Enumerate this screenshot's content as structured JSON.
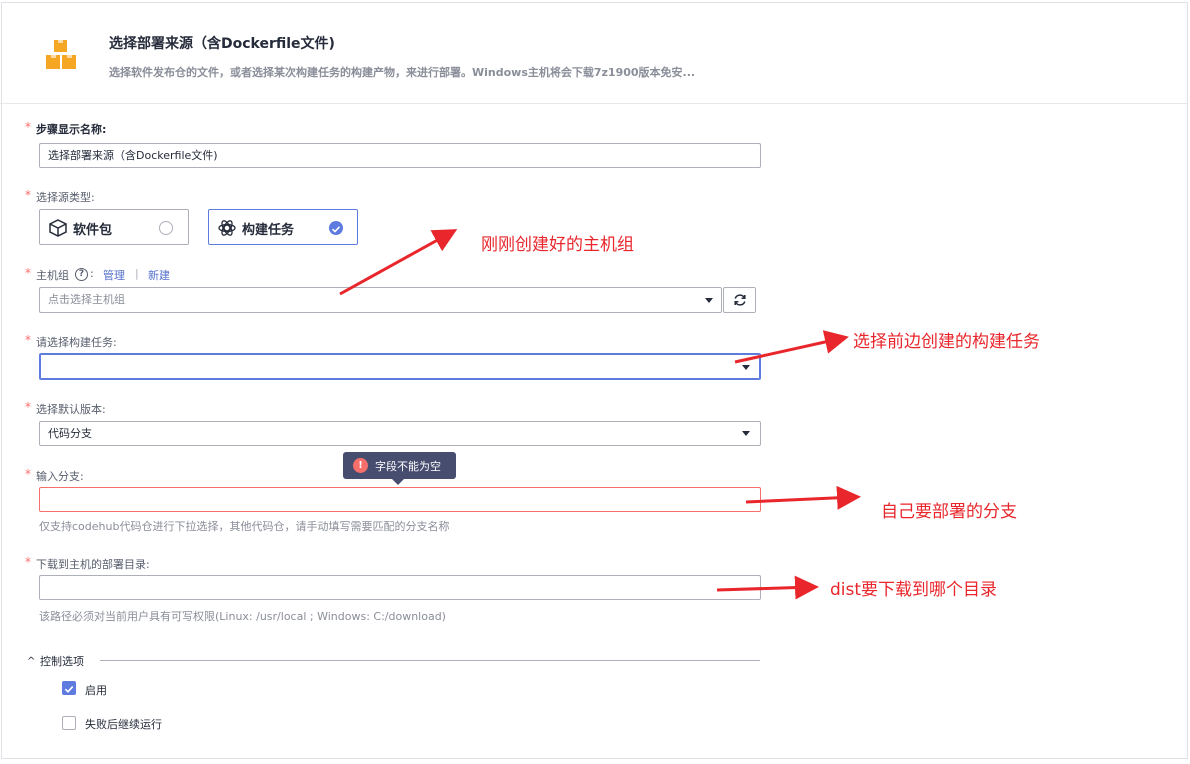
{
  "header": {
    "title": "选择部署来源（含Dockerfile文件)",
    "description": "选择软件发布仓的文件，或者选择某次构建任务的构建产物，来进行部署。Windows主机将会下载7z1900版本免安...",
    "icon": "box-stack-icon",
    "accent_color": "#f5a623"
  },
  "form": {
    "required_mark": "*",
    "step_name": {
      "label": "步骤显示名称:",
      "value": "选择部署来源（含Dockerfile文件)"
    },
    "source_type": {
      "label": "选择源类型:",
      "options": [
        {
          "label": "软件包",
          "icon": "package-icon",
          "selected": false
        },
        {
          "label": "构建任务",
          "icon": "build-gear-icon",
          "selected": true
        }
      ]
    },
    "host_group": {
      "label": "主机组",
      "help": "?",
      "colon": ":",
      "manage_link": "管理",
      "separator": "|",
      "new_link": "新建",
      "placeholder": "点击选择主机组"
    },
    "build_task": {
      "label": "请选择构建任务:",
      "value": ""
    },
    "default_version": {
      "label": "选择默认版本:",
      "value": "代码分支"
    },
    "branch": {
      "label": "输入分支:",
      "value": "",
      "error_tooltip": "字段不能为空",
      "hint": "仅支持codehub代码仓进行下拉选择，其他代码仓，请手动填写需要匹配的分支名称"
    },
    "deploy_dir": {
      "label": "下载到主机的部署目录:",
      "value": "",
      "hint": "该路径必须对当前用户具有可写权限(Linux: /usr/local ; Windows: C:/download)"
    }
  },
  "control_options": {
    "title": "控制选项",
    "items": [
      {
        "label": "启用",
        "checked": true
      },
      {
        "label": "失败后继续运行",
        "checked": false
      }
    ]
  },
  "annotations": {
    "color": "#e8262b",
    "host_group_note": "刚刚创建好的主机组",
    "build_task_note": "选择前边创建的构建任务",
    "branch_note": "自己要部署的分支",
    "dir_note": "dist要下载到哪个目录"
  },
  "colors": {
    "primary": "#5e7ce0",
    "error": "#f66f6a",
    "link": "#526ecc"
  }
}
